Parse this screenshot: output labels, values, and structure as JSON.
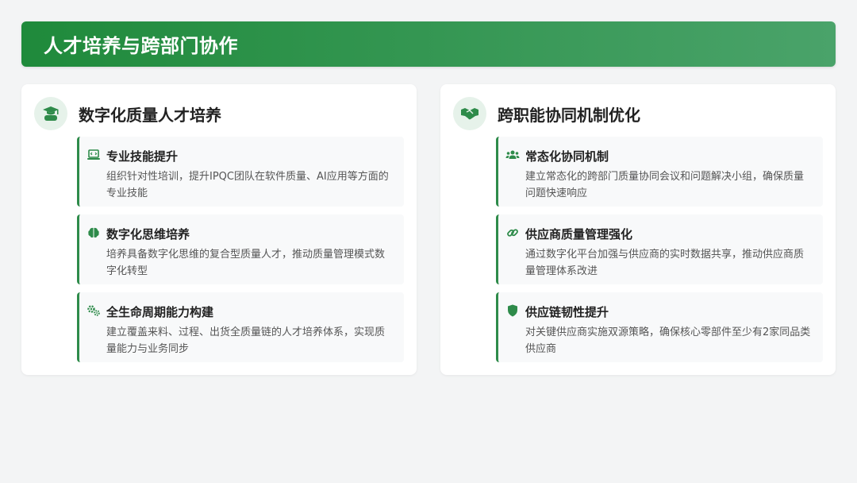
{
  "header": {
    "title": "人才培养与跨部门协作"
  },
  "left_panel": {
    "title": "数字化质量人才培养",
    "icon": "graduate-icon",
    "cards": [
      {
        "icon": "laptop-code-icon",
        "title": "专业技能提升",
        "desc": "组织针对性培训，提升IPQC团队在软件质量、AI应用等方面的专业技能"
      },
      {
        "icon": "brain-icon",
        "title": "数字化思维培养",
        "desc": "培养具备数字化思维的复合型质量人才，推动质量管理模式数字化转型"
      },
      {
        "icon": "gears-icon",
        "title": "全生命周期能力构建",
        "desc": "建立覆盖来料、过程、出货全质量链的人才培养体系，实现质量能力与业务同步"
      }
    ]
  },
  "right_panel": {
    "title": "跨职能协同机制优化",
    "icon": "handshake-icon",
    "cards": [
      {
        "icon": "users-icon",
        "title": "常态化协同机制",
        "desc": "建立常态化的跨部门质量协同会议和问题解决小组，确保质量问题快速响应"
      },
      {
        "icon": "link-icon",
        "title": "供应商质量管理强化",
        "desc": "通过数字化平台加强与供应商的实时数据共享，推动供应商质量管理体系改进"
      },
      {
        "icon": "shield-icon",
        "title": "供应链韧性提升",
        "desc": "对关键供应商实施双源策略，确保核心零部件至少有2家同品类供应商"
      }
    ]
  },
  "colors": {
    "accent": "#2e8b4a",
    "header_start": "#1f8a3b",
    "header_end": "#4aa36a",
    "icon_bg": "#e6f2ea"
  }
}
